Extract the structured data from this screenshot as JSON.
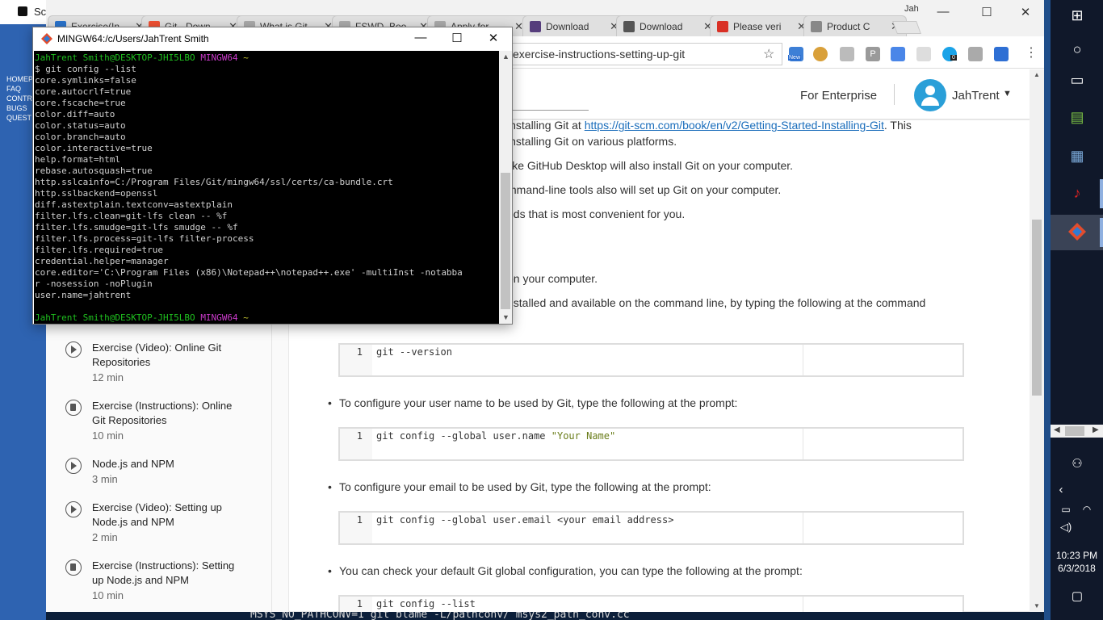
{
  "background_window": {
    "title": "Sc",
    "nav": [
      "HOMEP",
      "FAQ",
      "CONTR",
      "BUGS",
      "QUEST"
    ],
    "bottom_text": "MSYS_NO_PATHCONV=1 git blame -L/pathconv/ msys2_path_conv.cc"
  },
  "browser": {
    "tabs": [
      {
        "label": "Exercise(In",
        "icon": "coursera-icon",
        "color": "#2a73cc"
      },
      {
        "label": "Git - Down",
        "icon": "git-icon",
        "color": "#f05133"
      },
      {
        "label": "What is Git",
        "icon": "page-icon",
        "color": "#aaaaaa"
      },
      {
        "label": "FSWD_Boo",
        "icon": "page-icon",
        "color": "#aaaaaa"
      },
      {
        "label": "Apply for",
        "icon": "page-icon",
        "color": "#aaaaaa"
      },
      {
        "label": "Download",
        "icon": "bootstrap-icon",
        "color": "#563d7c"
      },
      {
        "label": "Download",
        "icon": "download-icon",
        "color": "#555555"
      },
      {
        "label": "Please veri",
        "icon": "gmail-icon",
        "color": "#d93025"
      },
      {
        "label": "Product C",
        "icon": "page-icon",
        "color": "#888888"
      }
    ],
    "profile": "Jah",
    "url": "exercise-instructions-setting-up-git",
    "extension_badges": {
      "new": "New",
      "count": "0"
    }
  },
  "page": {
    "nav": {
      "enterprise": "For Enterprise",
      "username": "JahTrent"
    },
    "paragraphs": [
      {
        "pre": "installing Git at ",
        "link": "https://git-scm.com/book/en/v2/Getting-Started-Installing-Git",
        "post": ". This"
      },
      {
        "text": "installing Git on various platforms."
      },
      {
        "text": "like GitHub Desktop will also install Git on your computer."
      },
      {
        "text": "mmand-line tools also will set up Git on your computer."
      },
      {
        "text": "ods that is most convenient for you."
      },
      {
        "text": "t"
      },
      {
        "text": "on your computer."
      },
      {
        "text": "nstalled and available on the command line, by typing the following at the command"
      }
    ],
    "bullets": [
      "To configure your user name to be used by Git, type the following at the prompt:",
      "To configure your email to be used by Git, type the following at the prompt:",
      "You can check your default Git global configuration, you can type the following at the prompt:"
    ],
    "code_blocks": [
      {
        "line": "1",
        "code": "git --version",
        "str": ""
      },
      {
        "line": "1",
        "code": "git config --global user.name ",
        "str": "\"Your Name\""
      },
      {
        "line": "1",
        "code": "git config --global user.email <your email address>",
        "str": ""
      },
      {
        "line": "1",
        "code": "git config --list",
        "str": ""
      }
    ],
    "sidebar": [
      {
        "title": "Exercise (Video): Online Git Repositories",
        "duration": "12 min",
        "type": "video"
      },
      {
        "title": "Exercise (Instructions): Online Git Repositories",
        "duration": "10 min",
        "type": "doc"
      },
      {
        "title": "Node.js and NPM",
        "duration": "3 min",
        "type": "video"
      },
      {
        "title": "Exercise (Video): Setting up Node.js and NPM",
        "duration": "2 min",
        "type": "video"
      },
      {
        "title": "Exercise (Instructions): Setting up Node.js and NPM",
        "duration": "10 min",
        "type": "doc"
      }
    ]
  },
  "terminal": {
    "title": "MINGW64:/c/Users/JahTrent Smith",
    "prompt_user": "JahTrent Smith@DESKTOP-JHI5LBO",
    "prompt_env": "MINGW64",
    "prompt_dir": "~",
    "command": "$ git config --list",
    "output": [
      "core.symlinks=false",
      "core.autocrlf=true",
      "core.fscache=true",
      "color.diff=auto",
      "color.status=auto",
      "color.branch=auto",
      "color.interactive=true",
      "help.format=html",
      "rebase.autosquash=true",
      "http.sslcainfo=C:/Program Files/Git/mingw64/ssl/certs/ca-bundle.crt",
      "http.sslbackend=openssl",
      "diff.astextplain.textconv=astextplain",
      "filter.lfs.clean=git-lfs clean -- %f",
      "filter.lfs.smudge=git-lfs smudge -- %f",
      "filter.lfs.process=git-lfs filter-process",
      "filter.lfs.required=true",
      "credential.helper=manager",
      "core.editor='C:\\Program Files (x86)\\Notepad++\\notepad++.exe' -multiInst -notabba",
      "r -nosession -noPlugin",
      "user.name=jahtrent"
    ]
  },
  "taskbar": {
    "time": "10:23 PM",
    "date": "6/3/2018"
  }
}
